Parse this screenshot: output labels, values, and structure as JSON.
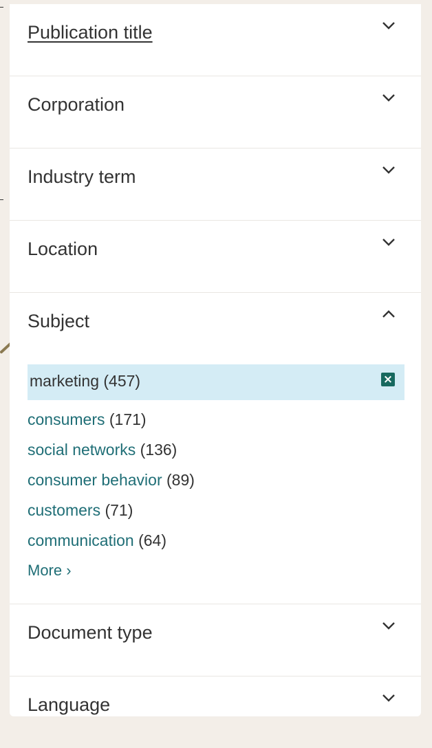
{
  "facets": {
    "publication_title": "Publication title",
    "corporation": "Corporation",
    "industry_term": "Industry term",
    "location": "Location",
    "subject": "Subject",
    "document_type": "Document type",
    "language": "Language"
  },
  "subject": {
    "selected": {
      "term": "marketing",
      "count": "(457)",
      "remove_symbol": "×"
    },
    "items": [
      {
        "term": "consumers",
        "count": "(171)"
      },
      {
        "term": "social networks",
        "count": "(136)"
      },
      {
        "term": "consumer behavior",
        "count": "(89)"
      },
      {
        "term": "customers",
        "count": "(71)"
      },
      {
        "term": "communication",
        "count": "(64)"
      }
    ],
    "more_label": "More ›"
  },
  "icons": {
    "expand": "chevron-down-icon",
    "collapse": "chevron-up-icon",
    "remove": "close-icon",
    "annotation": "arrow-icon"
  },
  "colors": {
    "link": "#1f6e76",
    "selected_bg": "#d4ecf5",
    "remove_bg": "#17695f",
    "arrow": "#8b7a52"
  }
}
